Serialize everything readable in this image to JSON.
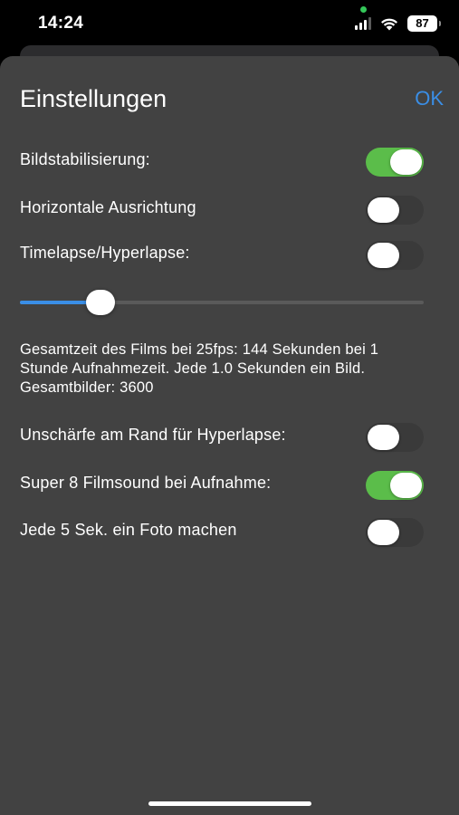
{
  "status_bar": {
    "time": "14:24",
    "battery": "87",
    "icons": [
      "privacy-indicator-dot",
      "cellular-signal-icon",
      "wifi-icon",
      "battery-icon"
    ],
    "colors": {
      "privacy_dot": "#34c759"
    }
  },
  "sheet": {
    "title": "Einstellungen",
    "ok_label": "OK",
    "colors": {
      "background": "#424242",
      "accent": "#3a8ee6",
      "toggle_on": "#5bbd4a"
    }
  },
  "settings": {
    "image_stabilization": {
      "label": "Bildstabilisierung:",
      "on": true
    },
    "horizontal_alignment": {
      "label": "Horizontale Ausrichtung",
      "on": false
    },
    "timelapse": {
      "label": "Timelapse/Hyperlapse:",
      "on": false
    },
    "interval_slider": {
      "value_fraction": 0.2
    },
    "info": "Gesamtzeit des Films bei 25fps: 144 Sekunden bei 1 Stunde Aufnahmezeit. Jede 1.0 Sekunden ein Bild. Gesamtbilder: 3600",
    "edge_blur": {
      "label": "Unschärfe am Rand für Hyperlapse:",
      "on": false
    },
    "super8_sound": {
      "label": "Super 8 Filmsound bei Aufnahme:",
      "on": true
    },
    "photo_interval": {
      "label": "Jede 5 Sek. ein Foto machen",
      "on": false
    }
  }
}
